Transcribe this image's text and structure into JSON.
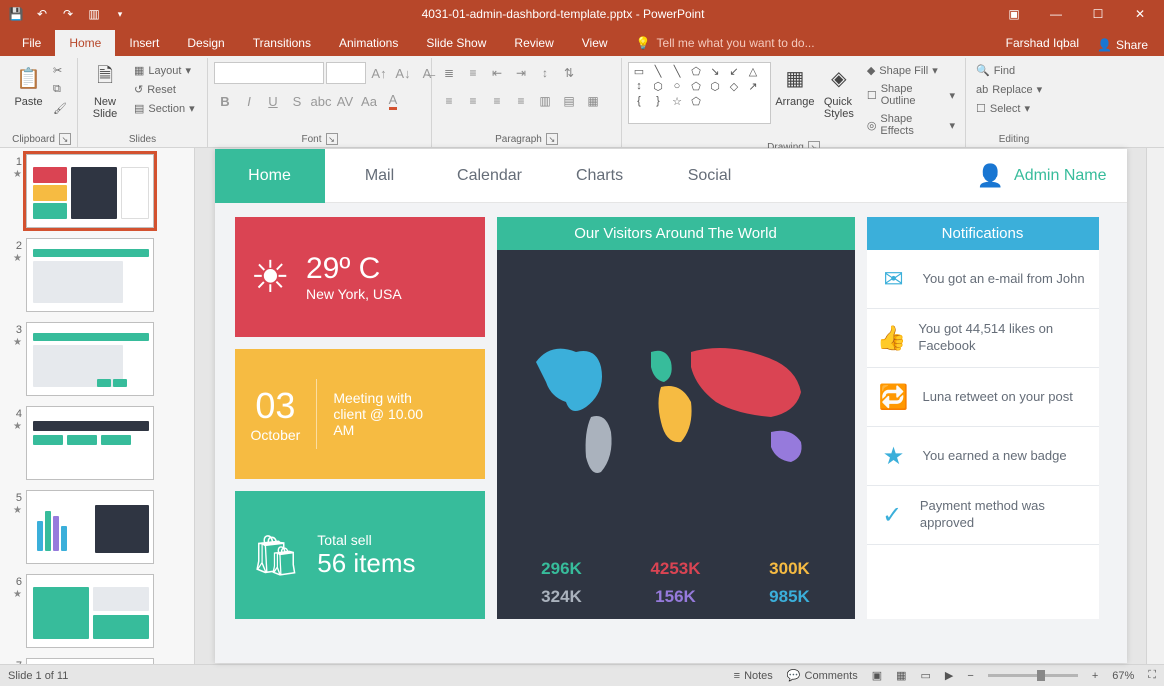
{
  "app": {
    "title": "4031-01-admin-dashbord-template.pptx - PowerPoint",
    "user": "Farshad Iqbal",
    "share": "Share"
  },
  "menu": {
    "tabs": [
      "File",
      "Home",
      "Insert",
      "Design",
      "Transitions",
      "Animations",
      "Slide Show",
      "Review",
      "View"
    ],
    "active": "Home",
    "tell_me": "Tell me what you want to do..."
  },
  "ribbon": {
    "clipboard": {
      "label": "Clipboard",
      "paste": "Paste"
    },
    "slides": {
      "label": "Slides",
      "new_slide": "New\nSlide",
      "layout": "Layout",
      "reset": "Reset",
      "section": "Section"
    },
    "font": {
      "label": "Font"
    },
    "paragraph": {
      "label": "Paragraph"
    },
    "drawing": {
      "label": "Drawing",
      "arrange": "Arrange",
      "quick_styles": "Quick\nStyles",
      "shape_fill": "Shape Fill",
      "shape_outline": "Shape Outline",
      "shape_effects": "Shape Effects"
    },
    "editing": {
      "label": "Editing",
      "find": "Find",
      "replace": "Replace",
      "select": "Select"
    }
  },
  "thumbs": {
    "count": 7
  },
  "slide": {
    "nav": [
      "Home",
      "Mail",
      "Calendar",
      "Charts",
      "Social"
    ],
    "nav_active": "Home",
    "admin": "Admin Name",
    "weather": {
      "temp": "29º C",
      "loc": "New York, USA"
    },
    "meeting": {
      "day": "03",
      "month": "October",
      "text": "Meeting with client @ 10.00 AM"
    },
    "sell": {
      "label": "Total sell",
      "val": "56 items"
    },
    "visitors_title": "Our Visitors Around The World",
    "stats": [
      {
        "v": "296K",
        "c": "#37BC9B"
      },
      {
        "v": "4253K",
        "c": "#DA4453"
      },
      {
        "v": "300K",
        "c": "#F6BB42"
      },
      {
        "v": "324K",
        "c": "#AAB2BD"
      },
      {
        "v": "156K",
        "c": "#967ADC"
      },
      {
        "v": "985K",
        "c": "#3BAFDA"
      }
    ],
    "notif_title": "Notifications",
    "notifs": [
      {
        "t": "You got an e-mail from John"
      },
      {
        "t": "You got 44,514 likes on Facebook"
      },
      {
        "t": "Luna retweet on your post"
      },
      {
        "t": "You earned a new badge"
      },
      {
        "t": "Payment method was approved"
      }
    ]
  },
  "status": {
    "slide": "Slide 1 of 11",
    "notes": "Notes",
    "comments": "Comments",
    "zoom": "67%"
  }
}
